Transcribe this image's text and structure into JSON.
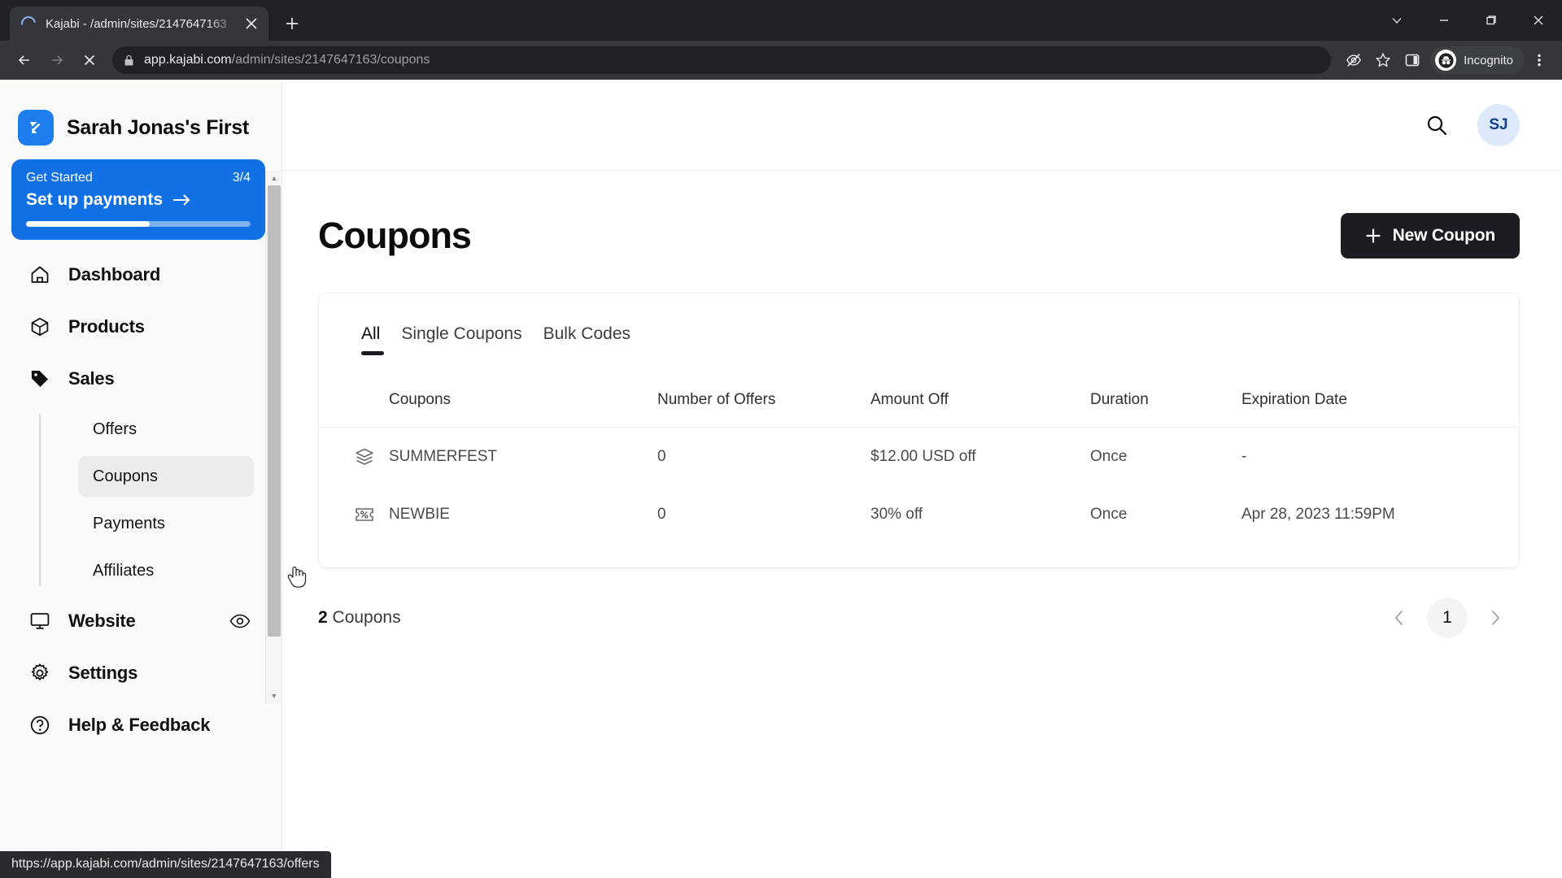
{
  "browser": {
    "tab": {
      "title": "Kajabi - /admin/sites/2147647163",
      "favicon": "loading-spinner-icon",
      "close_label": "✕"
    },
    "new_tab_label": "+",
    "window_controls": {
      "collapse": "⌄",
      "minimize": "—",
      "maximize": "❐",
      "close": "✕"
    },
    "nav": {
      "back": "←",
      "forward": "→",
      "stop": "✕"
    },
    "omnibox": {
      "domain": "app.kajabi.com",
      "path": "/admin/sites/2147647163/coupons",
      "lock_icon": "lock-icon"
    },
    "toolbar_icons": {
      "tracking_protection": "eye-slash-icon",
      "bookmark": "star-icon",
      "side_panel": "side-panel-icon",
      "menu": "three-dot-menu-icon"
    },
    "incognito_label": "Incognito",
    "status_url": "https://app.kajabi.com/admin/sites/2147647163/offers"
  },
  "sidebar": {
    "brand": {
      "name": "Sarah Jonas's First",
      "logo_icon": "kajabi-logo-icon"
    },
    "get_started": {
      "label": "Get Started",
      "count": "3/4",
      "action": "Set up payments",
      "arrow": "→",
      "progress_percent": 55,
      "accent_color": "#1170e4"
    },
    "items": [
      {
        "label": "Dashboard",
        "icon": "home-icon",
        "active": false
      },
      {
        "label": "Products",
        "icon": "box-icon",
        "active": false
      },
      {
        "label": "Sales",
        "icon": "tag-icon",
        "active": false
      },
      {
        "label": "Website",
        "icon": "monitor-icon",
        "active": false,
        "trailing_icon": "eye-icon"
      },
      {
        "label": "Settings",
        "icon": "gear-icon",
        "active": false
      },
      {
        "label": "Help & Feedback",
        "icon": "question-circle-icon",
        "active": false
      }
    ],
    "sub_items": [
      {
        "label": "Offers",
        "active": false
      },
      {
        "label": "Coupons",
        "active": true
      },
      {
        "label": "Payments",
        "active": false
      },
      {
        "label": "Affiliates",
        "active": false
      }
    ]
  },
  "topbar": {
    "search_icon": "search-icon",
    "avatar_initials": "SJ",
    "avatar_bg": "#dce9fb",
    "avatar_fg": "#16408f"
  },
  "main": {
    "title": "Coupons",
    "new_coupon_button": "New Coupon",
    "new_coupon_plus": "+",
    "tabs": [
      {
        "label": "All",
        "active": true
      },
      {
        "label": "Single Coupons",
        "active": false
      },
      {
        "label": "Bulk Codes",
        "active": false
      }
    ],
    "table": {
      "columns": [
        "Coupons",
        "Number of Offers",
        "Amount Off",
        "Duration",
        "Expiration Date"
      ],
      "rows": [
        {
          "icon": "layers-icon",
          "name": "SUMMERFEST",
          "number_of_offers": "0",
          "amount_off": "$12.00 USD off",
          "duration": "Once",
          "expiration_date": "-"
        },
        {
          "icon": "coupon-ticket-icon",
          "name": "NEWBIE",
          "number_of_offers": "0",
          "amount_off": "30% off",
          "duration": "Once",
          "expiration_date": "Apr 28, 2023 11:59PM"
        }
      ]
    },
    "footer": {
      "count_value": "2",
      "count_label": " Coupons",
      "prev_label": "‹",
      "current_page": "1",
      "next_label": "›"
    }
  }
}
